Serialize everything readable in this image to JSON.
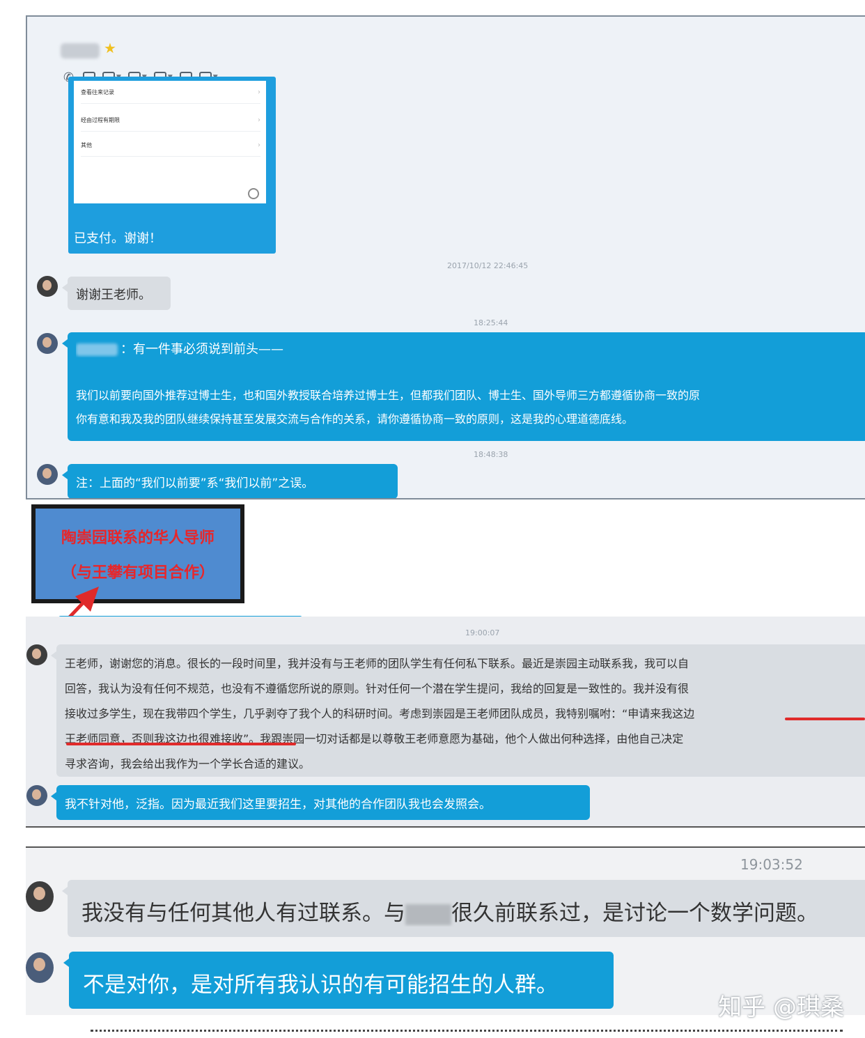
{
  "panel1": {
    "contact_name_hidden": "",
    "quote_card": {
      "rows": [
        "查看往来记录",
        "经由过程有期限",
        "其他"
      ],
      "caption": "已支付。谢谢！"
    },
    "timestamps": [
      "2017/10/12 22:46:45",
      "18:25:44",
      "18:48:38"
    ],
    "messages": [
      {
        "side": "gray",
        "text": "谢谢王老师。"
      },
      {
        "side": "blue",
        "header": "：有一件事必须说到前头——",
        "lines": [
          "我们以前要向国外推荐过博士生，也和国外教授联合培养过博士生，但都我们团队、博士生、国外导师三方都遵循协商一致的原",
          "你有意和我及我的团队继续保持甚至发展交流与合作的关系，请你遵循协商一致的原则，这是我的心理道德底线。"
        ]
      },
      {
        "side": "blue",
        "text": "注：上面的“我们以前要”系“我们以前”之误。"
      }
    ]
  },
  "annotation": {
    "line1": "陶崇园联系的华人导师",
    "line2": "（与王攀有项目合作）"
  },
  "panel2": {
    "timestamp": "19:00:07",
    "messages": [
      {
        "side": "gray",
        "lines": [
          "王老师，谢谢您的消息。很长的一段时间里，我并没有与王老师的团队学生有任何私下联系。最近是崇园主动联系我，我可以自",
          "回答，我认为没有任何不规范，也没有不遵循您所说的原则。针对任何一个潜在学生提问，我给的回复是一致性的。我并没有很",
          "接收过多学生，现在我带四个学生，几乎剥夺了我个人的科研时间。考虑到崇园是王老师团队成员，我特别嘱咐：“申请来我这边",
          "王老师同意，否则我这边也很难接收”。我跟崇园一切对话都是以尊敬王老师意愿为基础，他个人做出何种选择，由他自己决定",
          "寻求咨询，我会给出我作为一个学长合适的建议。"
        ]
      },
      {
        "side": "blue",
        "text": "我不针对他，泛指。因为最近我们这里要招生，对其他的合作团队我也会发照会。"
      }
    ]
  },
  "panel3": {
    "timestamp": "19:03:52",
    "messages": [
      {
        "side": "gray",
        "before": "我没有与任何其他人有过联系。与",
        "after": "很久前联系过，是讨论一个数学问题。"
      },
      {
        "side": "blue",
        "text": "不是对你，是对所有我认识的有可能招生的人群。"
      }
    ]
  },
  "watermark": "知乎 @琪桑",
  "colors": {
    "bubble_blue": "#139ed8",
    "bubble_gray": "#d9dde2",
    "annotation_text": "#e8262a",
    "annotation_bg": "#4f8bd0",
    "underline": "#e02a2a"
  },
  "icons": [
    "phone-icon",
    "video-icon",
    "screen-share-icon",
    "file-icon",
    "remote-desktop-icon",
    "add-icon",
    "apps-icon"
  ]
}
